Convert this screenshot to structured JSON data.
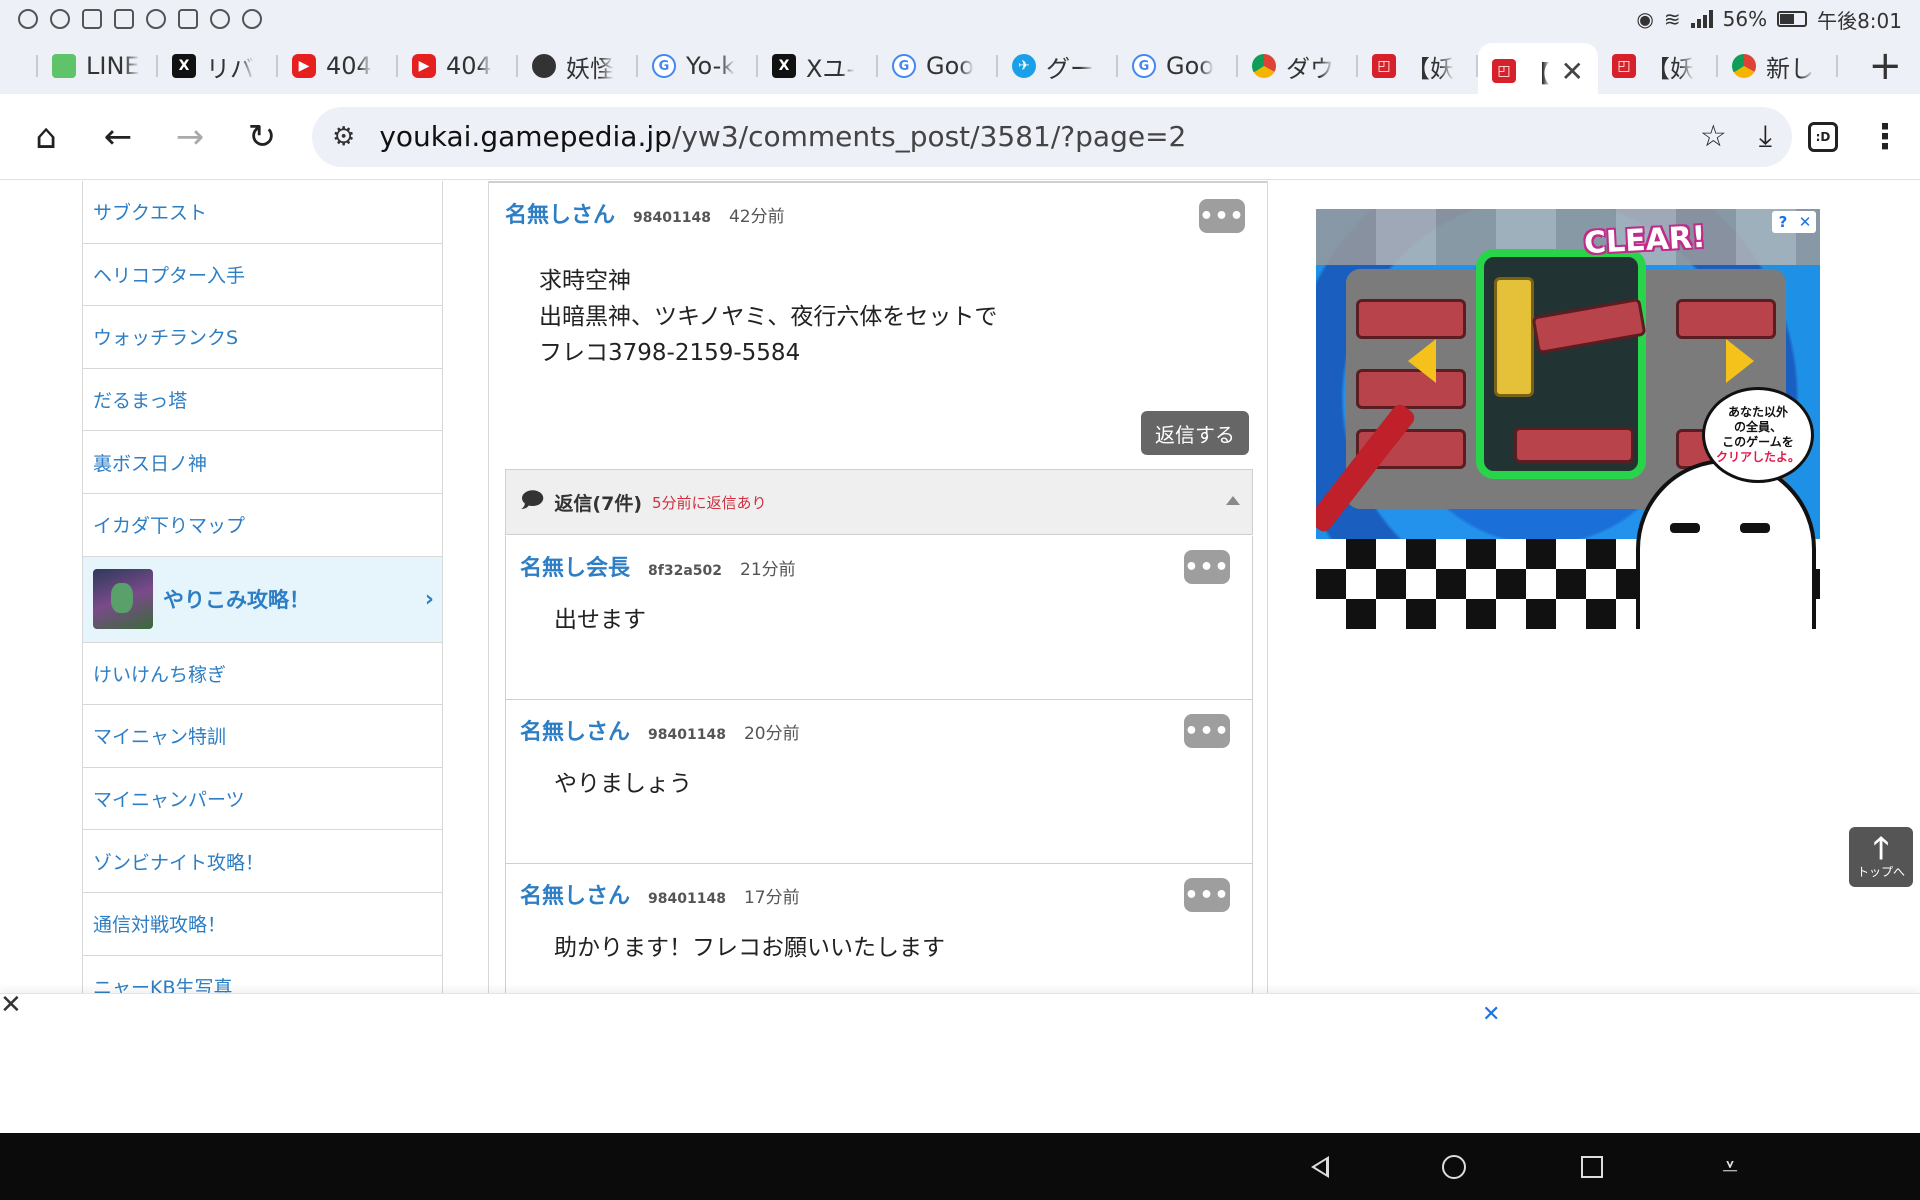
{
  "status_bar": {
    "battery_percent": "56%",
    "time": "午後8:01"
  },
  "tabs": [
    {
      "label": "LINE",
      "favicon": "line-icon"
    },
    {
      "label": "リバ",
      "favicon": "x-icon"
    },
    {
      "label": "404",
      "favicon": "youtube-icon"
    },
    {
      "label": "404",
      "favicon": "youtube-icon"
    },
    {
      "label": "妖怪",
      "favicon": "ninja-icon"
    },
    {
      "label": "Yo-k",
      "favicon": "google-icon"
    },
    {
      "label": "Xユ-",
      "favicon": "x-icon"
    },
    {
      "label": "Goo",
      "favicon": "google-icon"
    },
    {
      "label": "グー",
      "favicon": "plane-icon"
    },
    {
      "label": "Goo",
      "favicon": "google-icon"
    },
    {
      "label": "ダウ",
      "favicon": "chrome-icon"
    },
    {
      "label": "【妖",
      "favicon": "gamepedia-icon"
    },
    {
      "label": "【",
      "favicon": "gamepedia-icon",
      "active": true
    },
    {
      "label": "【妖",
      "favicon": "gamepedia-icon"
    },
    {
      "label": "新し",
      "favicon": "chrome-icon"
    }
  ],
  "toolbar": {
    "url_host": "youkai.gamepedia.jp",
    "url_path": "/yw3/comments_post/3581/?page=2",
    "tab_switcher_label": ":D"
  },
  "sidebar": {
    "items_top": [
      "サブクエスト",
      "ヘリコプター入手",
      "ウォッチランクS",
      "だるまっ塔",
      "裏ボス日ノ神",
      "イカダ下りマップ"
    ],
    "feature": {
      "label": "やりこみ攻略！",
      "arrow": "›"
    },
    "items_bottom": [
      "けいけんち稼ぎ",
      "マイニャン特訓",
      "マイニャンパーツ",
      "ゾンビナイト攻略！",
      "通信対戦攻略！",
      "ニャーKB生写真"
    ]
  },
  "main_comment": {
    "name": "名無しさん",
    "id": "98401148",
    "time": "42分前",
    "lines": [
      "求時空神",
      "出暗黒神、ツキノヤミ、夜行六体をセットで",
      "フレコ3798-2159-5584"
    ],
    "reply_button": "返信する",
    "more_label": "•••"
  },
  "replies": {
    "title": "返信(7件)",
    "latest": "5分前に返信あり",
    "icon": "speech-bubble-icon",
    "items": [
      {
        "name": "名無し会長",
        "id": "8f32a502",
        "time": "21分前",
        "body": "出せます"
      },
      {
        "name": "名無しさん",
        "id": "98401148",
        "time": "20分前",
        "body": "やりましょう"
      },
      {
        "name": "名無しさん",
        "id": "98401148",
        "time": "17分前",
        "body": "助かります！フレコお願いいたします"
      }
    ]
  },
  "ad": {
    "headline": "CLEAR!",
    "bubble_line1": "あなた以外",
    "bubble_line2": "の全員、",
    "bubble_line3": "このゲームを",
    "bubble_emph": "クリアしたよ。",
    "info": "?",
    "close": "✕"
  },
  "back_to_top": {
    "arrow": "🡑",
    "label": "トップへ"
  },
  "bottom_ad": {
    "close_left": "✕",
    "close_right": "✕"
  }
}
